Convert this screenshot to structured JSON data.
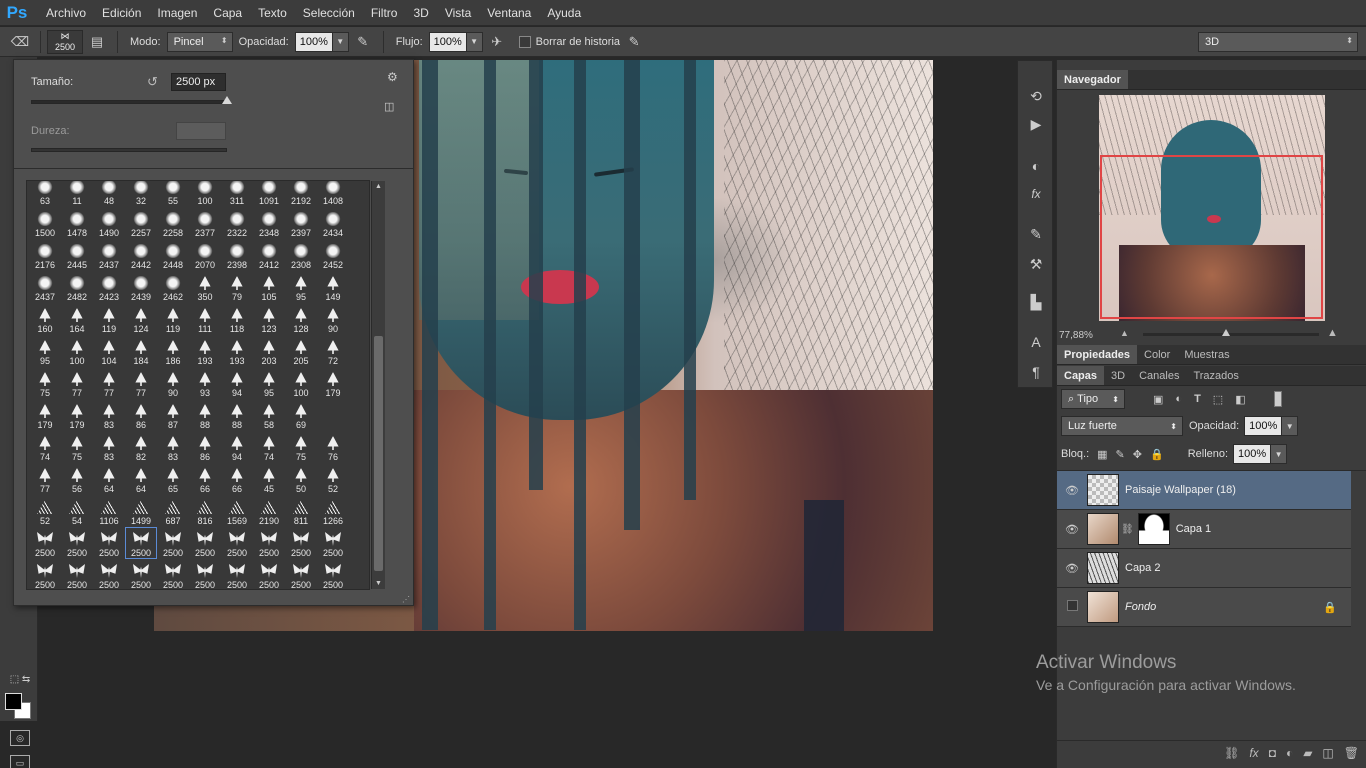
{
  "app": {
    "logo": "Ps"
  },
  "menu": [
    "Archivo",
    "Edición",
    "Imagen",
    "Capa",
    "Texto",
    "Selección",
    "Filtro",
    "3D",
    "Vista",
    "Ventana",
    "Ayuda"
  ],
  "options": {
    "brush_size": "2500",
    "mode_label": "Modo:",
    "mode_value": "Pincel",
    "opacity_label": "Opacidad:",
    "opacity_value": "100%",
    "flow_label": "Flujo:",
    "flow_value": "100%",
    "erase_history_label": "Borrar de historia",
    "workspace": "3D"
  },
  "brush_panel": {
    "size_label": "Tamaño:",
    "size_value": "2500 px",
    "hardness_label": "Dureza:",
    "size_slider": 1.0,
    "brushes": [
      {
        "v": "63",
        "t": "blob"
      },
      {
        "v": "11",
        "t": "blob"
      },
      {
        "v": "48",
        "t": "blob"
      },
      {
        "v": "32",
        "t": "blob"
      },
      {
        "v": "55",
        "t": "blob"
      },
      {
        "v": "100",
        "t": "blob"
      },
      {
        "v": "311",
        "t": "blob"
      },
      {
        "v": "1091",
        "t": "blob"
      },
      {
        "v": "2192",
        "t": "blob"
      },
      {
        "v": "1408",
        "t": "blob"
      },
      {
        "v": "1500",
        "t": "blob"
      },
      {
        "v": "1478",
        "t": "blob"
      },
      {
        "v": "1490",
        "t": "blob"
      },
      {
        "v": "2257",
        "t": "blob"
      },
      {
        "v": "2258",
        "t": "blob"
      },
      {
        "v": "2377",
        "t": "blob"
      },
      {
        "v": "2322",
        "t": "blob"
      },
      {
        "v": "2348",
        "t": "blob"
      },
      {
        "v": "2397",
        "t": "blob"
      },
      {
        "v": "2434",
        "t": "blob"
      },
      {
        "v": "2176",
        "t": "blob"
      },
      {
        "v": "2445",
        "t": "blob"
      },
      {
        "v": "2437",
        "t": "blob"
      },
      {
        "v": "2442",
        "t": "blob"
      },
      {
        "v": "2448",
        "t": "blob"
      },
      {
        "v": "2070",
        "t": "blob"
      },
      {
        "v": "2398",
        "t": "blob"
      },
      {
        "v": "2412",
        "t": "blob"
      },
      {
        "v": "2308",
        "t": "blob"
      },
      {
        "v": "2452",
        "t": "blob"
      },
      {
        "v": "2437",
        "t": "blob"
      },
      {
        "v": "2482",
        "t": "blob"
      },
      {
        "v": "2423",
        "t": "blob"
      },
      {
        "v": "2439",
        "t": "blob"
      },
      {
        "v": "2462",
        "t": "blob"
      },
      {
        "v": "350",
        "t": "tree"
      },
      {
        "v": "79",
        "t": "tree"
      },
      {
        "v": "105",
        "t": "tree"
      },
      {
        "v": "95",
        "t": "tree"
      },
      {
        "v": "149",
        "t": "tree"
      },
      {
        "v": "160",
        "t": "tree"
      },
      {
        "v": "164",
        "t": "tree"
      },
      {
        "v": "119",
        "t": "tree"
      },
      {
        "v": "124",
        "t": "tree"
      },
      {
        "v": "119",
        "t": "tree"
      },
      {
        "v": "111",
        "t": "tree"
      },
      {
        "v": "118",
        "t": "tree"
      },
      {
        "v": "123",
        "t": "tree"
      },
      {
        "v": "128",
        "t": "tree"
      },
      {
        "v": "90",
        "t": "tree"
      },
      {
        "v": "95",
        "t": "tree"
      },
      {
        "v": "100",
        "t": "tree"
      },
      {
        "v": "104",
        "t": "tree"
      },
      {
        "v": "184",
        "t": "tree"
      },
      {
        "v": "186",
        "t": "tree"
      },
      {
        "v": "193",
        "t": "tree"
      },
      {
        "v": "193",
        "t": "tree"
      },
      {
        "v": "203",
        "t": "tree"
      },
      {
        "v": "205",
        "t": "tree"
      },
      {
        "v": "72",
        "t": "tree"
      },
      {
        "v": "75",
        "t": "tree"
      },
      {
        "v": "77",
        "t": "tree"
      },
      {
        "v": "77",
        "t": "tree"
      },
      {
        "v": "77",
        "t": "tree"
      },
      {
        "v": "90",
        "t": "tree"
      },
      {
        "v": "93",
        "t": "tree"
      },
      {
        "v": "94",
        "t": "tree"
      },
      {
        "v": "95",
        "t": "tree"
      },
      {
        "v": "100",
        "t": "tree"
      },
      {
        "v": "179",
        "t": "tree"
      },
      {
        "v": "179",
        "t": "tree"
      },
      {
        "v": "179",
        "t": "tree"
      },
      {
        "v": "83",
        "t": "tree"
      },
      {
        "v": "86",
        "t": "tree"
      },
      {
        "v": "87",
        "t": "tree"
      },
      {
        "v": "88",
        "t": "tree"
      },
      {
        "v": "88",
        "t": "tree"
      },
      {
        "v": "58",
        "t": "tree"
      },
      {
        "v": "69",
        "t": "tree"
      },
      {
        "v": "",
        "t": "none"
      },
      {
        "v": "74",
        "t": "tree"
      },
      {
        "v": "75",
        "t": "tree"
      },
      {
        "v": "83",
        "t": "tree"
      },
      {
        "v": "82",
        "t": "tree"
      },
      {
        "v": "83",
        "t": "tree"
      },
      {
        "v": "86",
        "t": "tree"
      },
      {
        "v": "94",
        "t": "tree"
      },
      {
        "v": "74",
        "t": "tree"
      },
      {
        "v": "75",
        "t": "tree"
      },
      {
        "v": "76",
        "t": "tree"
      },
      {
        "v": "77",
        "t": "tree"
      },
      {
        "v": "56",
        "t": "tree"
      },
      {
        "v": "64",
        "t": "tree"
      },
      {
        "v": "64",
        "t": "tree"
      },
      {
        "v": "65",
        "t": "tree"
      },
      {
        "v": "66",
        "t": "tree"
      },
      {
        "v": "66",
        "t": "tree"
      },
      {
        "v": "45",
        "t": "tree"
      },
      {
        "v": "50",
        "t": "tree"
      },
      {
        "v": "52",
        "t": "tree"
      },
      {
        "v": "52",
        "t": "branch"
      },
      {
        "v": "54",
        "t": "branch"
      },
      {
        "v": "1106",
        "t": "branch"
      },
      {
        "v": "1499",
        "t": "branch"
      },
      {
        "v": "687",
        "t": "branch"
      },
      {
        "v": "816",
        "t": "branch"
      },
      {
        "v": "1569",
        "t": "branch"
      },
      {
        "v": "2190",
        "t": "branch"
      },
      {
        "v": "811",
        "t": "branch"
      },
      {
        "v": "1266",
        "t": "branch"
      },
      {
        "v": "2500",
        "t": "bf"
      },
      {
        "v": "2500",
        "t": "bf"
      },
      {
        "v": "2500",
        "t": "bf"
      },
      {
        "v": "2500",
        "t": "bf",
        "sel": true
      },
      {
        "v": "2500",
        "t": "bf"
      },
      {
        "v": "2500",
        "t": "bf"
      },
      {
        "v": "2500",
        "t": "bf"
      },
      {
        "v": "2500",
        "t": "bf"
      },
      {
        "v": "2500",
        "t": "bf"
      },
      {
        "v": "2500",
        "t": "bf"
      },
      {
        "v": "2500",
        "t": "bf"
      },
      {
        "v": "2500",
        "t": "bf"
      },
      {
        "v": "2500",
        "t": "bf"
      },
      {
        "v": "2500",
        "t": "bf"
      },
      {
        "v": "2500",
        "t": "bf"
      },
      {
        "v": "2500",
        "t": "bf"
      },
      {
        "v": "2500",
        "t": "bf"
      },
      {
        "v": "2500",
        "t": "bf"
      },
      {
        "v": "2500",
        "t": "bf"
      },
      {
        "v": "2500",
        "t": "bf"
      }
    ]
  },
  "navigator": {
    "tab": "Navegador",
    "zoom": "77,88%"
  },
  "properties_tabs": [
    "Propiedades",
    "Color",
    "Muestras"
  ],
  "layers_tabs": [
    "Capas",
    "3D",
    "Canales",
    "Trazados"
  ],
  "layers": {
    "filter_kind": "Tipo",
    "blend_mode": "Luz fuerte",
    "opacity_label": "Opacidad:",
    "opacity_value": "100%",
    "lock_label": "Bloq.:",
    "fill_label": "Relleno:",
    "fill_value": "100%",
    "items": [
      {
        "name": "Paisaje Wallpaper (18)",
        "visible": true,
        "selected": true
      },
      {
        "name": "Capa 1",
        "visible": true,
        "selected": false,
        "mask": true
      },
      {
        "name": "Capa 2",
        "visible": true,
        "selected": false
      },
      {
        "name": "Fondo",
        "visible": false,
        "selected": false,
        "locked": true
      }
    ]
  },
  "watermark": {
    "line1": "Activar Windows",
    "line2": "Ve a Configuración para activar Windows."
  }
}
